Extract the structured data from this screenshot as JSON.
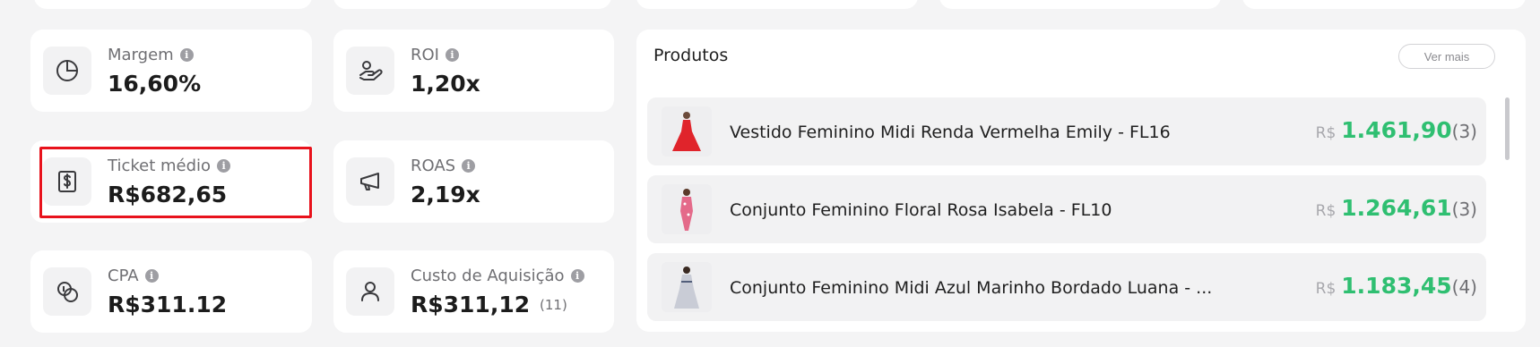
{
  "metrics": {
    "margem": {
      "label": "Margem",
      "value": "16,60%",
      "icon": "pie-chart-icon"
    },
    "roi": {
      "label": "ROI",
      "value": "1,20x",
      "icon": "hand-coins-icon"
    },
    "ticket": {
      "label": "Ticket médio",
      "value": "R$682,65",
      "icon": "dollar-receipt-icon"
    },
    "roas": {
      "label": "ROAS",
      "value": "2,19x",
      "icon": "megaphone-icon"
    },
    "cpa": {
      "label": "CPA",
      "value": "R$311.12",
      "icon": "coins-icon"
    },
    "custo": {
      "label": "Custo de Aquisição",
      "value": "R$311,12",
      "count": "(11)",
      "icon": "user-icon"
    }
  },
  "info_glyph": "i",
  "products": {
    "title": "Produtos",
    "ver_mais": "Ver mais",
    "items": [
      {
        "name": "Vestido Feminino Midi Renda Vermelha Emily - FL16",
        "currency": "R$",
        "amount": "1.461,90",
        "qty": "(3)",
        "dress_color": "#e0242b"
      },
      {
        "name": "Conjunto Feminino Floral Rosa Isabela - FL10",
        "currency": "R$",
        "amount": "1.264,61",
        "qty": "(3)",
        "dress_color": "#e46a8a"
      },
      {
        "name": "Conjunto Feminino Midi Azul Marinho Bordado Luana - ...",
        "currency": "R$",
        "amount": "1.183,45",
        "qty": "(4)",
        "dress_color": "#c9ccd6"
      }
    ]
  },
  "colors": {
    "accent_green": "#2fbf71",
    "highlight_red": "#e8121c"
  }
}
